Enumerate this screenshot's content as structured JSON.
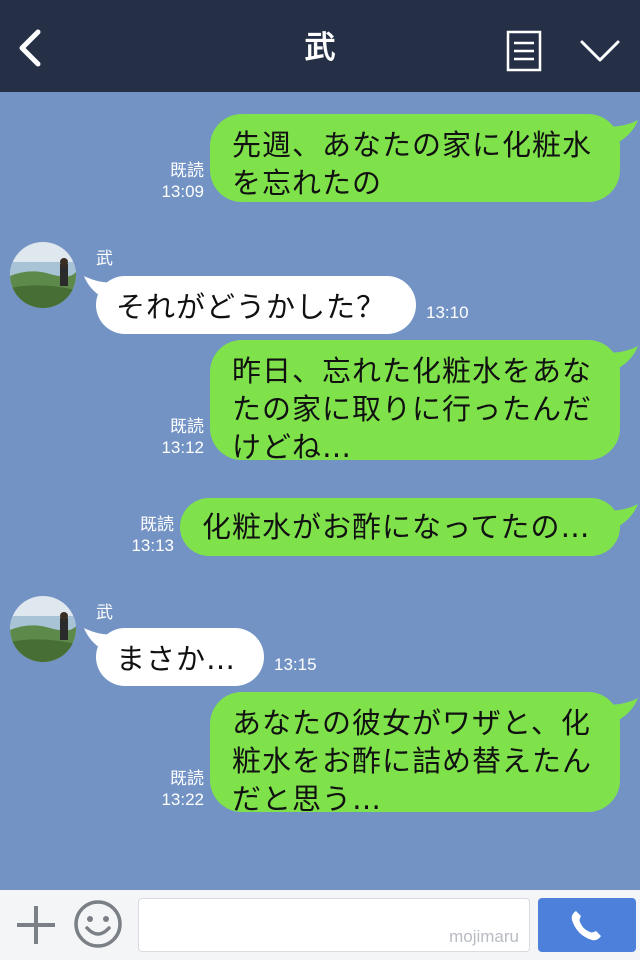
{
  "header": {
    "title": "武",
    "back_icon": "chevron-left-icon",
    "notes_icon": "notes-icon",
    "menu_icon": "chevron-down-icon",
    "bg_color": "#253047"
  },
  "chat": {
    "bg_color": "#7393c4",
    "me_bubble_color": "#7fe24b",
    "other_bubble_color": "#ffffff",
    "messages": [
      {
        "from": "me",
        "lines": [
          "先週、あなたの家に化粧水",
          "を忘れたの"
        ],
        "read": "既読",
        "time": "13:09"
      },
      {
        "from": "other",
        "sender": "武",
        "lines": [
          "それがどうかした？"
        ],
        "time": "13:10"
      },
      {
        "from": "me",
        "lines": [
          "昨日、忘れた化粧水をあな",
          "たの家に取りに行ったんだ",
          "けどね…"
        ],
        "read": "既読",
        "time": "13:12"
      },
      {
        "from": "me",
        "lines": [
          "化粧水がお酢になってたの…"
        ],
        "read": "既読",
        "time": "13:13"
      },
      {
        "from": "other",
        "sender": "武",
        "lines": [
          "まさか…"
        ],
        "time": "13:15"
      },
      {
        "from": "me",
        "lines": [
          "あなたの彼女がワザと、化",
          "粧水をお酢に詰め替えたん",
          "だと思う…"
        ],
        "read": "既読",
        "time": "13:22"
      }
    ]
  },
  "footer": {
    "plus_icon": "plus-icon",
    "emoji_icon": "smiley-icon",
    "input_value": "",
    "watermark": "mojimaru",
    "call_icon": "phone-icon",
    "call_color": "#4c80db"
  }
}
